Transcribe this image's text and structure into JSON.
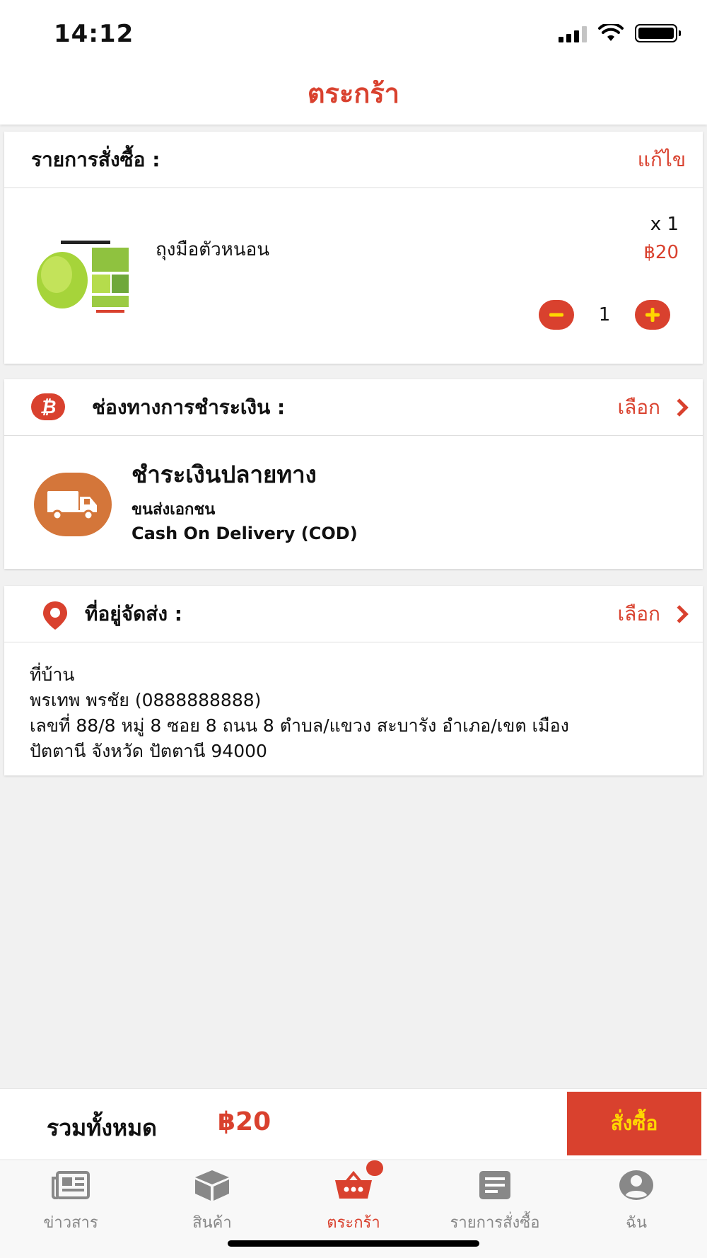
{
  "status": {
    "time": "14:12"
  },
  "nav": {
    "title": "ตระกร้า"
  },
  "order": {
    "header": "รายการสั่งซื้อ :",
    "edit_label": "แก้ไข",
    "item": {
      "name": "ถุงมือตัวหนอน",
      "qty_label": "x 1",
      "price": "฿20",
      "quantity": "1"
    }
  },
  "payment": {
    "header": "ช่องทางการชำระเงิน :",
    "select_label": "เลือก",
    "title": "ชำระเงินปลายทาง",
    "carrier": "ขนส่งเอกชน",
    "method": "Cash On Delivery (COD)"
  },
  "address": {
    "header": "ที่อยู่จัดส่ง :",
    "select_label": "เลือก",
    "lines": [
      "ที่บ้าน",
      "พรเทพ พรชัย (0888888888)",
      "เลขที่ 88/8 หมู่ 8 ซอย 8 ถนน 8  ตำบล/แขวง สะบารัง อำเภอ/เขต เมือง",
      "ปัตตานี  จังหวัด ปัตตานี 94000"
    ]
  },
  "total": {
    "label": "รวมทั้งหมด",
    "amount": "฿20",
    "checkout_label": "สั่งซื้อ"
  },
  "tabs": [
    {
      "label": "ข่าวสาร",
      "icon": "newspaper-icon"
    },
    {
      "label": "สินค้า",
      "icon": "box-icon"
    },
    {
      "label": "ตระกร้า",
      "icon": "basket-icon"
    },
    {
      "label": "รายการสั่งซื้อ",
      "icon": "order-list-icon"
    },
    {
      "label": "ฉัน",
      "icon": "user-icon"
    }
  ],
  "colors": {
    "accent": "#d9412e",
    "checkout_text": "#ffd700",
    "truck_badge": "#d4763a",
    "inactive_tab": "#888888"
  }
}
